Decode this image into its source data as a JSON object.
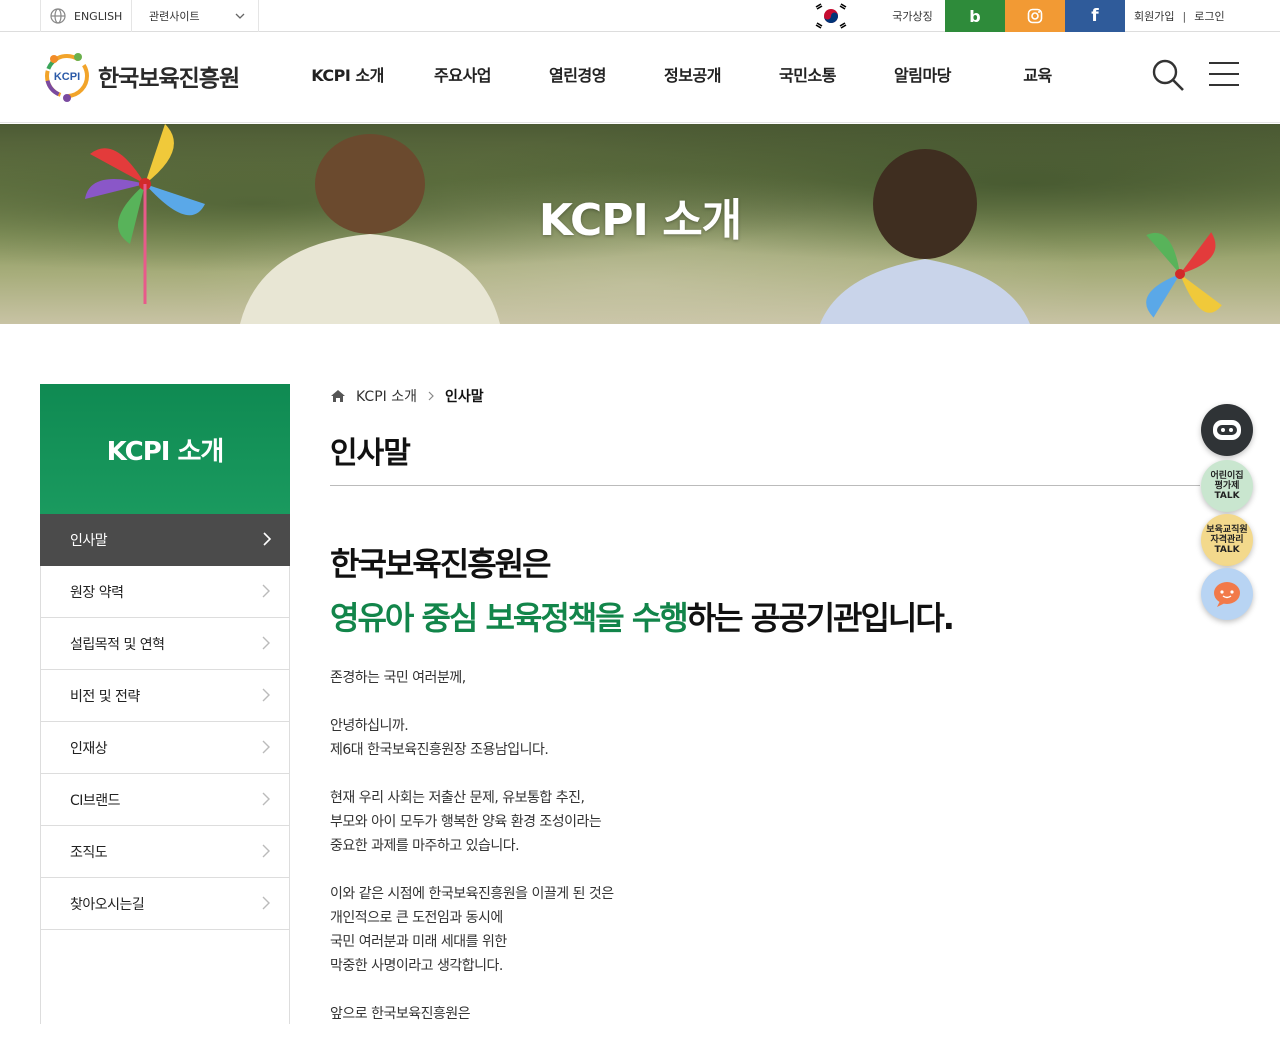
{
  "utility": {
    "english": "ENGLISH",
    "related_sites": "관련사이트",
    "national_symbol": "국가상징",
    "sns": {
      "blog": "b",
      "facebook": "f"
    },
    "join": "회원가입",
    "separator": "|",
    "login": "로그인"
  },
  "header": {
    "logo_mark": "KCPI",
    "logo_name": "한국보육진흥원",
    "nav": [
      "KCPI 소개",
      "주요사업",
      "열린경영",
      "정보공개",
      "국민소통",
      "알림마당",
      "교육"
    ]
  },
  "visual": {
    "title": "KCPI 소개"
  },
  "lnb": {
    "title": "KCPI 소개",
    "items": [
      "인사말",
      "원장 약력",
      "설립목적 및 연혁",
      "비전 및 전략",
      "인재상",
      "CI브랜드",
      "조직도",
      "찾아오시는길"
    ],
    "active_index": 0
  },
  "content": {
    "breadcrumb": {
      "parent": "KCPI 소개",
      "current": "인사말"
    },
    "page_title": "인사말",
    "headline": {
      "line1": "한국보육진흥원은",
      "line2_highlight": "영유아 중심 보육정책을 수행",
      "line2_rest": "하는 공공기관입니다."
    },
    "paragraphs": [
      [
        "존경하는 국민 여러분께,"
      ],
      [
        "안녕하십니까.",
        "제6대 한국보육진흥원장 조용남입니다."
      ],
      [
        "현재 우리 사회는 저출산 문제, 유보통합 추진,",
        "부모와 아이 모두가 행복한 양육 환경 조성이라는",
        "중요한 과제를 마주하고 있습니다."
      ],
      [
        "이와 같은 시점에 한국보육진흥원을 이끌게 된 것은",
        "개인적으로 큰 도전임과 동시에",
        "국민 여러분과 미래 세대를 위한",
        "막중한 사명이라고 생각합니다."
      ],
      [
        "앞으로 한국보육진흥원은"
      ]
    ]
  },
  "quick": {
    "talk1": [
      "어린이집",
      "평가제",
      "TALK"
    ],
    "talk2": [
      "보육교직원",
      "자격관리",
      "TALK"
    ]
  },
  "colors": {
    "brand_green": "#12854a",
    "lnb_active": "#4b4b4b",
    "blog": "#2e8b3a",
    "instagram": "#f29a34",
    "facebook": "#2f5b9a"
  }
}
